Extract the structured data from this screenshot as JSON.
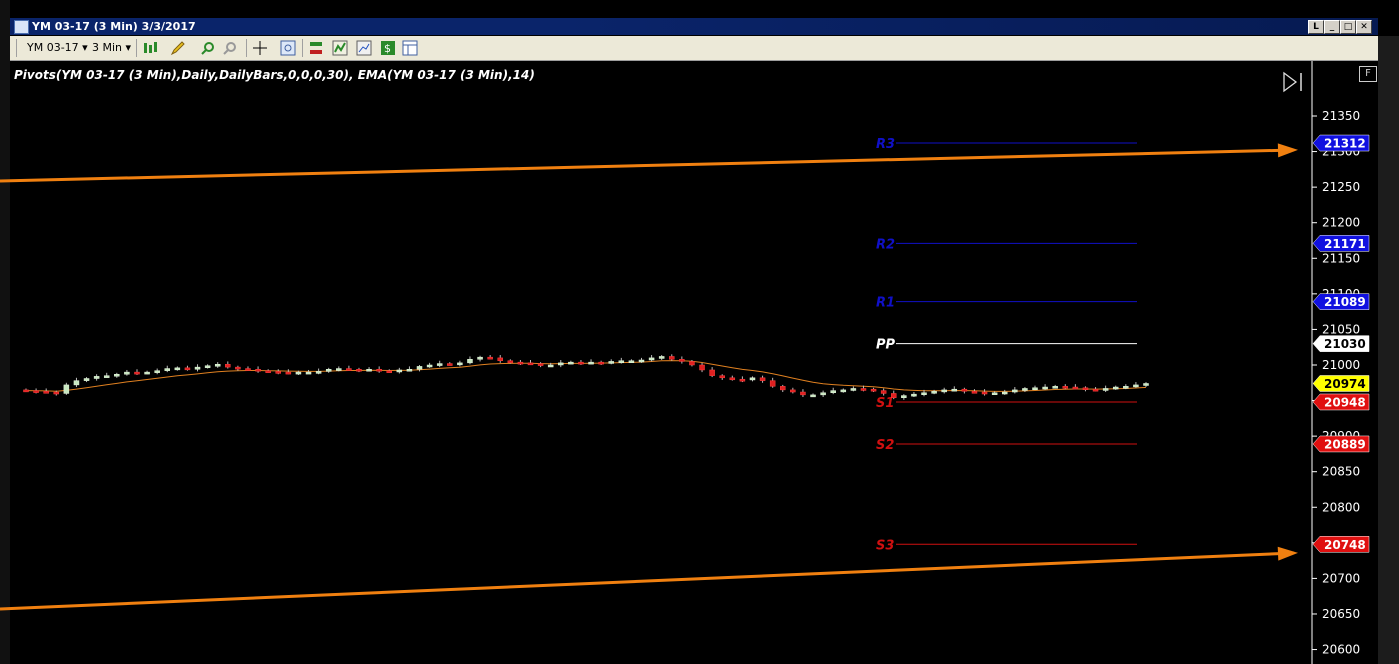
{
  "window": {
    "title": "YM 03-17 (3 Min)  3/3/2017",
    "buttons": [
      "L",
      "_",
      "□",
      "✕"
    ]
  },
  "toolbar": {
    "instrument": "YM 03-17",
    "interval": "3 Min",
    "icons": [
      "candlestick-style-icon",
      "pencil-draw-icon",
      "zoom-in-icon",
      "zoom-out-icon",
      "crosshair-icon",
      "magnifier-icon",
      "strategies-icon",
      "indicators-icon",
      "chart-properties-icon",
      "dollar-icon",
      "data-box-icon"
    ]
  },
  "legend": {
    "text": "Pivots(YM 03-17 (3 Min),Daily,DailyBars,0,0,0,30), EMA(YM 03-17 (3 Min),14)"
  },
  "f_button": "F",
  "colors": {
    "resistance": "#1010c8",
    "support": "#d01010",
    "pp": "#ffffff",
    "ema": "#e08020",
    "bull": "#c8e8c0",
    "bear": "#e02020",
    "arrow": "#f08010",
    "last_price_tag": "#ffff00"
  },
  "chart_data": {
    "type": "candlestick",
    "instrument": "YM 03-17",
    "interval": "3 Min",
    "date": "3/3/2017",
    "ylim": [
      20590,
      21405
    ],
    "y_ticks": [
      20600,
      20650,
      20700,
      20750,
      20800,
      20850,
      20900,
      20950,
      21000,
      21050,
      21100,
      21150,
      21200,
      21250,
      21300,
      21350
    ],
    "pivots": [
      {
        "name": "R3",
        "value": 21312,
        "color": "resistance"
      },
      {
        "name": "R2",
        "value": 21171,
        "color": "resistance"
      },
      {
        "name": "R1",
        "value": 21089,
        "color": "resistance"
      },
      {
        "name": "PP",
        "value": 21030,
        "color": "pp"
      },
      {
        "name": "S1",
        "value": 20948,
        "color": "support"
      },
      {
        "name": "S2",
        "value": 20889,
        "color": "support"
      },
      {
        "name": "S3",
        "value": 20748,
        "color": "support"
      }
    ],
    "last_price": 20974,
    "candles": [
      20964,
      20963,
      20962,
      20960,
      20972,
      20978,
      20981,
      20984,
      20985,
      20987,
      20990,
      20989,
      20990,
      20992,
      20995,
      20996,
      20994,
      20997,
      20999,
      21001,
      20997,
      20995,
      20994,
      20992,
      20991,
      20990,
      20989,
      20990,
      20990,
      20991,
      20994,
      20995,
      20994,
      20993,
      20994,
      20992,
      20991,
      20993,
      20994,
      20998,
      21000,
      21002,
      21001,
      21003,
      21008,
      21011,
      21010,
      21006,
      21004,
      21003,
      21002,
      21000,
      21000,
      21003,
      21004,
      21003,
      21004,
      21003,
      21005,
      21006,
      21006,
      21007,
      21010,
      21012,
      21008,
      21005,
      21000,
      20993,
      20985,
      20982,
      20980,
      20979,
      20982,
      20978,
      20970,
      20965,
      20962,
      20958,
      20958,
      20961,
      20964,
      20965,
      20967,
      20966,
      20964,
      20960,
      20954,
      20957,
      20959,
      20961,
      20963,
      20965,
      20966,
      20963,
      20962,
      20960,
      20961,
      20962,
      20965,
      20967,
      20968,
      20969,
      20970,
      20969,
      20968,
      20966,
      20965,
      20967,
      20969,
      20970,
      20972,
      20974
    ]
  }
}
